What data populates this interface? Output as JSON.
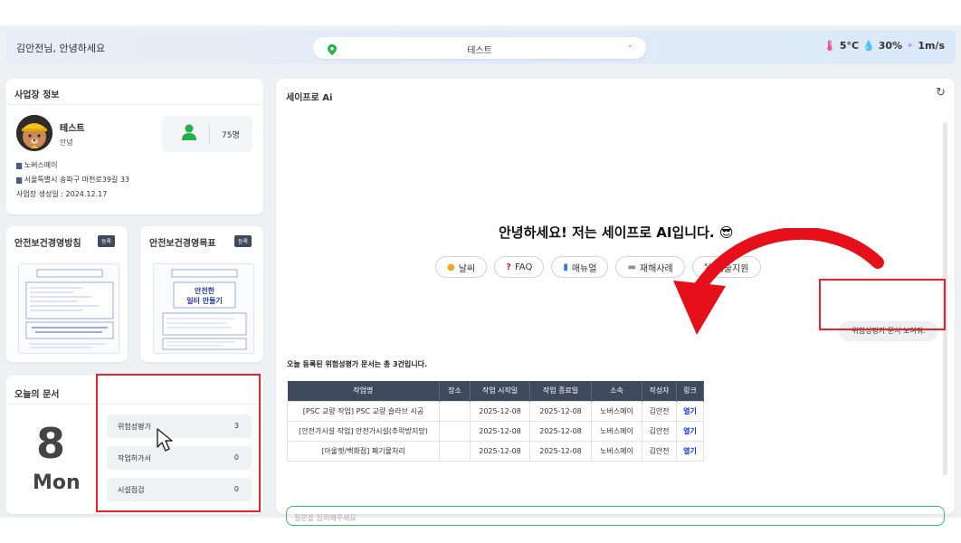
{
  "header": {
    "greeting": "김안전님, 안녕하세요",
    "site_select": "테스트",
    "weather": {
      "temp": "5°C",
      "humidity": "30%",
      "wind": "1m/s"
    }
  },
  "workplace": {
    "title": "사업장 정보",
    "name": "테스트",
    "greeting": "안녕",
    "worker_count": "75명",
    "company": "노버스메이",
    "address": "서울특별시 송파구 마천로39길 33",
    "created": "사업장 생성일 : 2024.12.17"
  },
  "policy": {
    "title": "안전보건경영방침",
    "badge": "등록"
  },
  "goal": {
    "title": "안전보건경영목표",
    "badge": "등록",
    "thumb_text": "안전한 일터 만들기"
  },
  "today": {
    "title": "오늘의 문서",
    "day_num": "8",
    "day_name": "Mon",
    "rows": [
      {
        "label": "위험성평가",
        "count": "3"
      },
      {
        "label": "작업허가서",
        "count": "0"
      },
      {
        "label": "시설점검",
        "count": "0"
      }
    ]
  },
  "chat": {
    "title": "세이프로 Ai",
    "welcome": "안녕하세요! 저는 세이프로 AI입니다.",
    "chips": [
      "날씨",
      "FAQ",
      "매뉴얼",
      "재해사례",
      "기술지원"
    ],
    "suggestion": "위험성평가 문서 보여줘.",
    "result_msg": "오늘 등록된 위험성평가 문서는 총 3건입니다.",
    "table": {
      "headers": [
        "작업명",
        "장소",
        "작업 시작일",
        "작업 종료일",
        "소속",
        "작성자",
        "링크"
      ],
      "rows": [
        [
          "[PSC 교량 작업] PSC 교량 슬라브 시공",
          "",
          "2025-12-08",
          "2025-12-08",
          "노버스메이",
          "김안전",
          "열기"
        ],
        [
          "[안전가시설 작업] 안전가시설(추락방지망)",
          "",
          "2025-12-08",
          "2025-12-08",
          "노버스메이",
          "김안전",
          "열기"
        ],
        [
          "[아울렛/백화점] 폐기물처리",
          "",
          "2025-12-08",
          "2025-12-08",
          "노버스메이",
          "김안전",
          "열기"
        ]
      ]
    },
    "input_placeholder": "질문을 입력해주세요"
  },
  "colors": {
    "accent_green": "#34c26a",
    "highlight_red": "#e5252a",
    "header_dark": "#3d4b5c",
    "link_blue": "#1a35d8"
  }
}
